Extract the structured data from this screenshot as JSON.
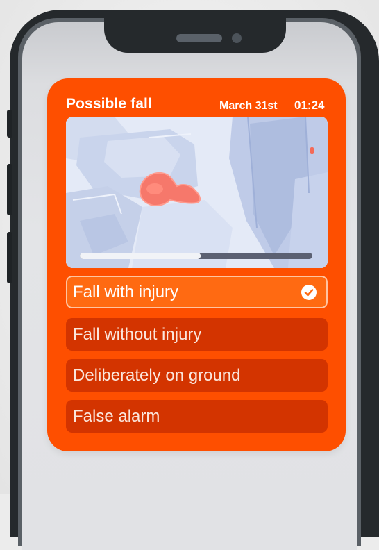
{
  "alert": {
    "title": "Possible fall",
    "date": "March 31st",
    "time": "01:24"
  },
  "video": {
    "progress": 0.52
  },
  "options": [
    {
      "label": "Fall with injury",
      "selected": true
    },
    {
      "label": "Fall without injury",
      "selected": false
    },
    {
      "label": "Deliberately on ground",
      "selected": false
    },
    {
      "label": "False alarm",
      "selected": false
    }
  ],
  "colors": {
    "card": "#fe4f00",
    "option": "#d33400",
    "option_selected": "#ff6a12",
    "phone_frame": "#25292c"
  }
}
